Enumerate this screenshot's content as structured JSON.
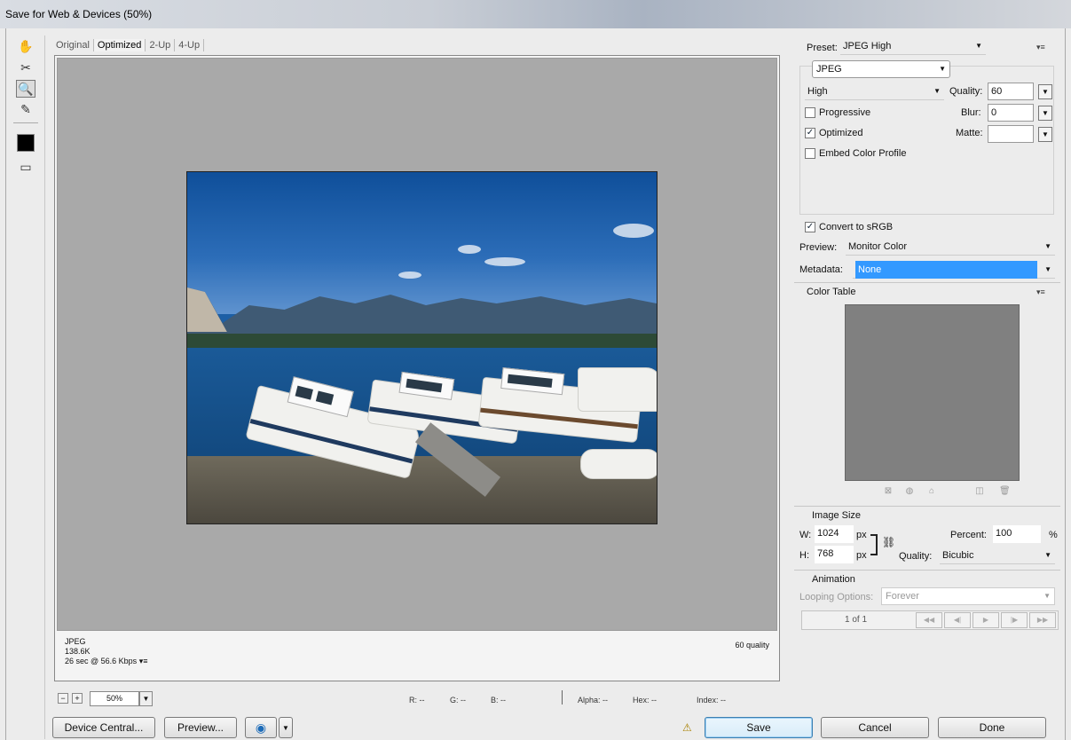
{
  "window": {
    "title": "Save for Web & Devices (50%)"
  },
  "tools": [
    "hand-tool-icon",
    "slice-select-icon",
    "zoom-tool-icon",
    "eyedropper-icon",
    "color-swatch",
    "toggle-slices-icon"
  ],
  "tabs": [
    {
      "label": "Original"
    },
    {
      "label": "Optimized"
    },
    {
      "label": "2-Up"
    },
    {
      "label": "4-Up"
    }
  ],
  "canvas_info": {
    "format": "JPEG",
    "size": "138.6K",
    "time": "26 sec @ 56.6 Kbps",
    "quality": "60 quality"
  },
  "zoom": {
    "value": "50%"
  },
  "readouts": {
    "r": "R: --",
    "g": "G: --",
    "b": "B: --",
    "alpha": "Alpha: --",
    "hex": "Hex: --",
    "index": "Index: --"
  },
  "buttons": {
    "device_central": "Device Central...",
    "preview": "Preview...",
    "save": "Save",
    "cancel": "Cancel",
    "done": "Done"
  },
  "settings": {
    "preset_label": "Preset:",
    "preset_value": "JPEG High",
    "format": "JPEG",
    "quality_level": "High",
    "quality_label": "Quality:",
    "quality_value": "60",
    "progressive_label": "Progressive",
    "progressive": false,
    "blur_label": "Blur:",
    "blur_value": "0",
    "optimized_label": "Optimized",
    "optimized": true,
    "matte_label": "Matte:",
    "embed_label": "Embed Color Profile",
    "embed": false,
    "convert_label": "Convert to sRGB",
    "convert": true,
    "preview_label": "Preview:",
    "preview_value": "Monitor Color",
    "metadata_label": "Metadata:",
    "metadata_value": "None"
  },
  "color_table": {
    "title": "Color Table"
  },
  "image_size": {
    "title": "Image Size",
    "w_label": "W:",
    "w_value": "1024",
    "h_label": "H:",
    "h_value": "768",
    "unit": "px",
    "percent_label": "Percent:",
    "percent_value": "100",
    "percent_unit": "%",
    "quality_label": "Quality:",
    "quality_value": "Bicubic"
  },
  "animation": {
    "title": "Animation",
    "looping_label": "Looping Options:",
    "looping_value": "Forever",
    "frame": "1 of 1"
  },
  "colors": {
    "metadata_highlight": "#3399ff",
    "canvas_bg": "#a9a9a9"
  }
}
